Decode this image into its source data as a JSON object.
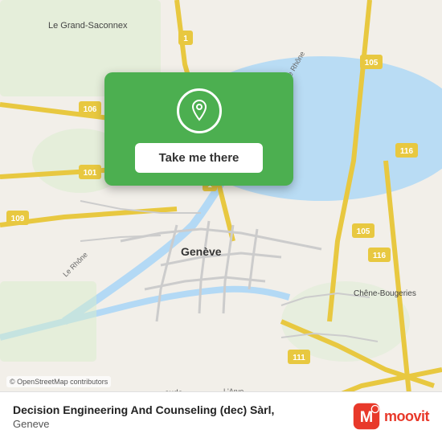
{
  "map": {
    "credit": "© OpenStreetMap contributors",
    "center_city": "Genève",
    "background_color": "#f2efe9"
  },
  "card": {
    "button_label": "Take me there",
    "icon_name": "location-pin-icon"
  },
  "bottom_panel": {
    "place_name": "Decision Engineering And Counseling (dec) Sàrl,",
    "place_city": "Geneve"
  },
  "moovit": {
    "logo_text": "moovit",
    "logo_icon": "moovit-icon"
  }
}
